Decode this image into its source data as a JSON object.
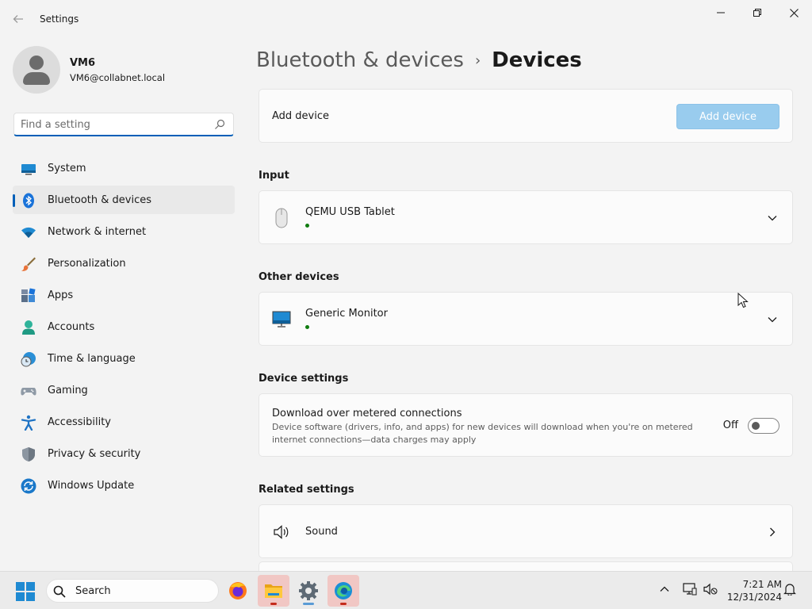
{
  "window": {
    "title": "Settings",
    "controls": {
      "minimize": "—",
      "maximize": "❐",
      "close": "✕"
    }
  },
  "profile": {
    "name": "VM6",
    "email": "VM6@collabnet.local"
  },
  "search": {
    "placeholder": "Find a setting"
  },
  "sidebar": {
    "items": [
      {
        "label": "System",
        "icon": "system-icon",
        "selected": false
      },
      {
        "label": "Bluetooth & devices",
        "icon": "bluetooth-icon",
        "selected": true
      },
      {
        "label": "Network & internet",
        "icon": "wifi-icon",
        "selected": false
      },
      {
        "label": "Personalization",
        "icon": "brush-icon",
        "selected": false
      },
      {
        "label": "Apps",
        "icon": "apps-icon",
        "selected": false
      },
      {
        "label": "Accounts",
        "icon": "accounts-icon",
        "selected": false
      },
      {
        "label": "Time & language",
        "icon": "time-language-icon",
        "selected": false
      },
      {
        "label": "Gaming",
        "icon": "gamepad-icon",
        "selected": false
      },
      {
        "label": "Accessibility",
        "icon": "accessibility-icon",
        "selected": false
      },
      {
        "label": "Privacy & security",
        "icon": "shield-icon",
        "selected": false
      },
      {
        "label": "Windows Update",
        "icon": "update-icon",
        "selected": false
      }
    ]
  },
  "breadcrumb": {
    "parent": "Bluetooth & devices",
    "separator": "›",
    "current": "Devices"
  },
  "main": {
    "add_device": {
      "label": "Add device",
      "button": "Add device"
    },
    "input": {
      "title": "Input",
      "devices": [
        {
          "name": "QEMU USB Tablet",
          "icon": "mouse-icon"
        }
      ]
    },
    "other": {
      "title": "Other devices",
      "devices": [
        {
          "name": "Generic Monitor",
          "icon": "monitor-icon"
        }
      ]
    },
    "device_settings": {
      "title": "Device settings",
      "metered": {
        "label": "Download over metered connections",
        "description": "Device software (drivers, info, and apps) for new devices will download when you're on metered internet connections—data charges may apply",
        "state": "Off"
      }
    },
    "related": {
      "title": "Related settings",
      "items": [
        {
          "label": "Sound",
          "icon": "speaker-icon"
        }
      ]
    }
  },
  "taskbar": {
    "search_label": "Search",
    "apps": [
      "firefox-icon",
      "file-explorer-icon",
      "settings-icon",
      "edge-icon"
    ],
    "clock": {
      "time": "7:21 AM",
      "date": "12/31/2024"
    }
  },
  "colors": {
    "accent": "#005fb8",
    "button_disabled": "#99ccee",
    "status_dot": "#107c10"
  }
}
